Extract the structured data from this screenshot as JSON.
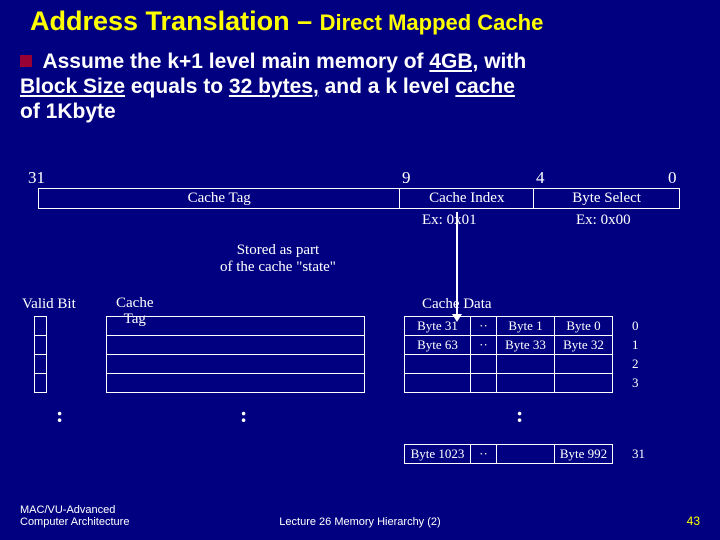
{
  "title": {
    "main": "Address Translation – ",
    "sub": "Direct Mapped Cache"
  },
  "bullet": {
    "pre": "Assume the k+1 level main memory of ",
    "u1": "4GB,",
    "mid1": " with ",
    "u2": "Block Size",
    "mid2": " equals to ",
    "u3": "32 bytes,",
    "mid3": " and a k level ",
    "u4": "cache",
    "post": " of 1Kbyte"
  },
  "bits": {
    "b31": "31",
    "b9": "9",
    "b4": "4",
    "b0": "0"
  },
  "addr": {
    "tag": "Cache Tag",
    "index": "Cache Index",
    "bsel": "Byte Select"
  },
  "ex": {
    "ci": "Ex: 0x01",
    "bs": "Ex: 0x00"
  },
  "stored": {
    "l1": "Stored as part",
    "l2": "of the cache \"state\""
  },
  "labels": {
    "vb": "Valid Bit",
    "ct1": "Cache",
    "ct2": "Tag",
    "cd": "Cache Data"
  },
  "data": {
    "r0": {
      "c0": "Byte 31",
      "dots": "··",
      "c1": "Byte 1",
      "c2": "Byte 0"
    },
    "r1": {
      "c0": "Byte 63",
      "dots": "··",
      "c1": "Byte 33",
      "c2": "Byte 32"
    },
    "rlast": {
      "c0": "Byte 1023",
      "dots": "··",
      "c1": "",
      "c2": "Byte 992"
    }
  },
  "rownums": {
    "r0": "0",
    "r1": "1",
    "r2": "2",
    "r3": "3",
    "rlast": "31"
  },
  "vdots": ":",
  "footer": {
    "left1": "MAC/VU-Advanced",
    "left2": "Computer Architecture",
    "mid": "Lecture 26 Memory Hierarchy (2)",
    "right": "43"
  }
}
